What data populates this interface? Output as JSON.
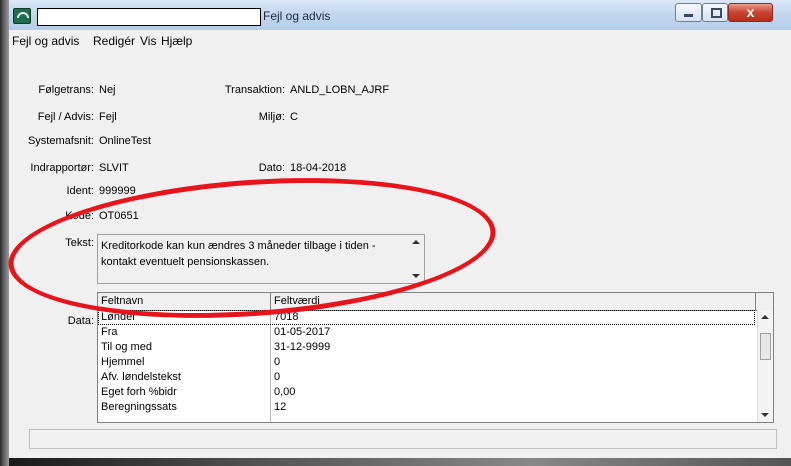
{
  "window": {
    "title": "Fejl og advis",
    "title_redacted_field": "",
    "close_glyph": "x"
  },
  "menu": [
    "Fejl og advis",
    "Redigér",
    "Vis",
    "Hjælp"
  ],
  "fields": {
    "folgetrans": {
      "label": "Følgetrans:",
      "value": "Nej"
    },
    "transaktion": {
      "label": "Transaktion:",
      "value": "ANLD_LOBN_AJRF"
    },
    "fejl_advis": {
      "label": "Fejl / Advis:",
      "value": "Fejl"
    },
    "miljo": {
      "label": "Miljø:",
      "value": "C"
    },
    "systemafsnit": {
      "label": "Systemafsnit:",
      "value": "OnlineTest"
    },
    "indrapportor": {
      "label": "Indrapportør:",
      "value": "SLVIT"
    },
    "dato": {
      "label": "Dato:",
      "value": "18-04-2018"
    },
    "ident": {
      "label": "Ident:",
      "value": "999999"
    },
    "kode": {
      "label": "Kode:",
      "value": "OT0651"
    },
    "tekst": {
      "label": "Tekst:",
      "value": "Kreditorkode kan kun ændres 3 måneder tilbage i tiden -\nkontakt eventuelt pensionskassen."
    }
  },
  "data_grid": {
    "label": "Data:",
    "columns": [
      "Feltnavn",
      "Feltværdi"
    ],
    "rows": [
      [
        "Løndel",
        "7018"
      ],
      [
        "Fra",
        "01-05-2017"
      ],
      [
        "Til og med",
        "31-12-9999"
      ],
      [
        "Hjemmel",
        "0"
      ],
      [
        "Afv. løndelstekst",
        "0"
      ],
      [
        "Eget forh %bidr",
        "0,00"
      ],
      [
        "Beregningssats",
        "12"
      ]
    ]
  },
  "status_text": "",
  "colors": {
    "annotation": "#e8141b",
    "titlebar": "#c3d8ee",
    "close_button": "#c8452f"
  },
  "icons": [
    "app-icon",
    "minimize-icon",
    "maximize-icon",
    "close-icon",
    "scroll-up-icon",
    "scroll-down-icon"
  ]
}
